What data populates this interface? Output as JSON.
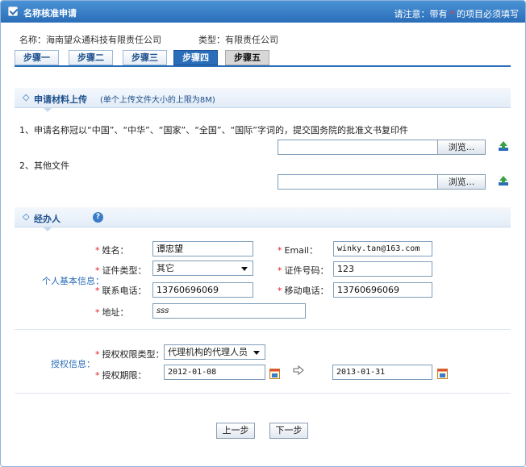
{
  "window": {
    "title": "名称核准申请",
    "notice_prefix": "请注意：带有",
    "notice_star": "*",
    "notice_suffix": "的项目必须填写"
  },
  "company": {
    "name_text": "名称：海南望众通科技有限责任公司",
    "type_text": "类型：有限责任公司"
  },
  "steps": [
    "步骤一",
    "步骤二",
    "步骤三",
    "步骤四",
    "步骤五"
  ],
  "upload_section": {
    "title": "申请材料上传",
    "note": "(单个上传文件大小的上限为8M)",
    "items": [
      {
        "label": "1、申请名称冠以“中国”、“中华”、“国家”、“全国”、“国际”字词的，提交国务院的批准文书复印件",
        "browse": "浏览..."
      },
      {
        "label": "2、其他文件",
        "browse": "浏览..."
      }
    ]
  },
  "agent_section": {
    "title": "经办人",
    "help": "?",
    "group_personal": "个人基本信息：",
    "group_auth": "授权信息：",
    "fields": {
      "name_label": "姓名：",
      "name_value": "谭忠望",
      "email_label": "Email：",
      "email_value": "winky.tan@163.com",
      "id_type_label": "证件类型：",
      "id_type_value": "其它",
      "id_number_label": "证件号码：",
      "id_number_value": "123",
      "phone_label": "联系电话：",
      "phone_value": "13760696069",
      "mobile_label": "移动电话：",
      "mobile_value": "13760696069",
      "address_label": "地址：",
      "address_value": "sss",
      "auth_type_label": "授权权限类型：",
      "auth_type_value": "代理机构的代理人员",
      "auth_period_label": "授权期限：",
      "auth_start": "2012-01-08",
      "auth_end": "2013-01-31"
    },
    "required_mark": "*"
  },
  "buttons": {
    "prev": "上一步",
    "next": "下一步"
  },
  "colors": {
    "accent": "#2a6db8",
    "required": "#e02020"
  }
}
